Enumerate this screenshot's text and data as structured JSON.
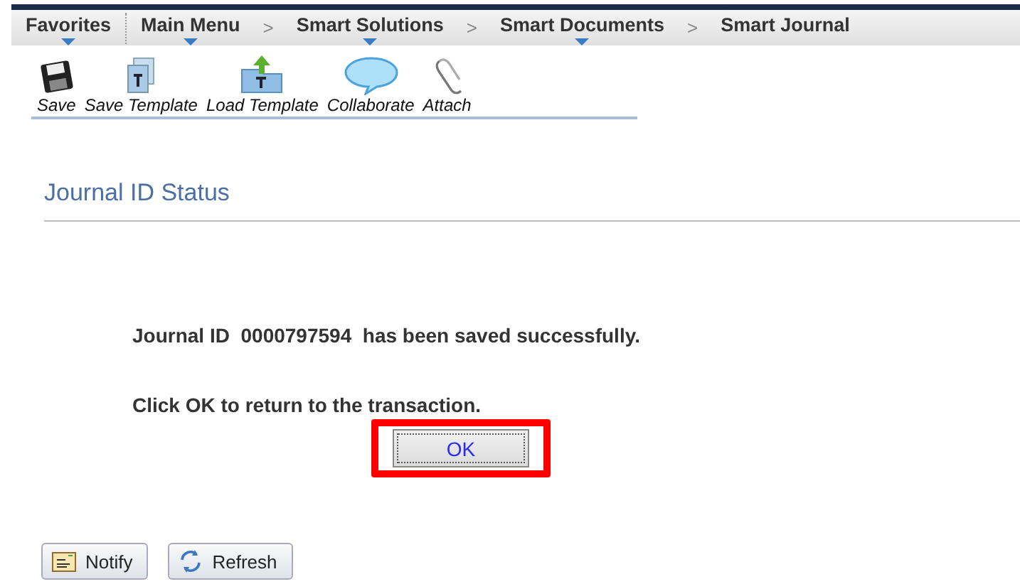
{
  "nav": [
    {
      "kind": "menu",
      "label": "Favorites",
      "menu": true
    },
    {
      "kind": "divider"
    },
    {
      "kind": "menu",
      "label": "Main Menu",
      "menu": true
    },
    {
      "kind": "separator",
      "label": ">"
    },
    {
      "kind": "menu",
      "label": "Smart Solutions",
      "menu": true
    },
    {
      "kind": "separator",
      "label": ">"
    },
    {
      "kind": "menu",
      "label": "Smart Documents",
      "menu": true
    },
    {
      "kind": "separator",
      "label": ">"
    },
    {
      "kind": "menu",
      "label": "Smart Journal",
      "menu": false
    }
  ],
  "toolbar": [
    {
      "kind": "save",
      "label": "Save"
    },
    {
      "kind": "save-template",
      "label": "Save Template"
    },
    {
      "kind": "load-template",
      "label": "Load Template"
    },
    {
      "kind": "collaborate",
      "label": "Collaborate"
    },
    {
      "kind": "attach",
      "label": "Attach"
    }
  ],
  "page_title": "Journal ID Status",
  "message": {
    "prefix": "Journal ID",
    "journal_id": "0000797594",
    "suffix": "has been saved successfully."
  },
  "instruction": "Click OK to return to the transaction.",
  "ok_button": {
    "label": "OK",
    "highlighted": true
  },
  "bottom_buttons": [
    {
      "kind": "notify",
      "label": "Notify"
    },
    {
      "kind": "refresh",
      "label": "Refresh"
    }
  ]
}
